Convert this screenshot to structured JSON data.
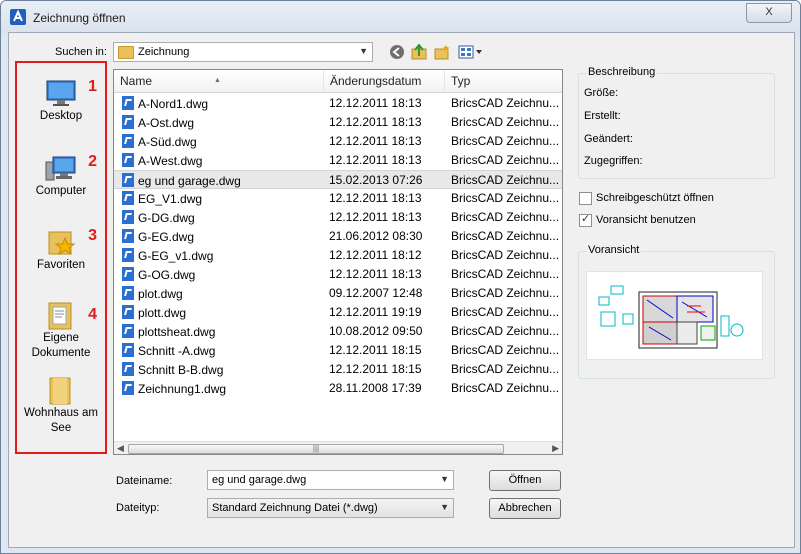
{
  "window": {
    "title": "Zeichnung öffnen",
    "close_glyph": "X"
  },
  "toolbar": {
    "look_in_label": "Suchen in:",
    "look_in_value": "Zeichnung",
    "icons": [
      "back-icon",
      "up-folder-icon",
      "new-folder-icon",
      "view-menu-icon"
    ]
  },
  "places": [
    {
      "label": "Desktop",
      "num": "1",
      "icon": "desktop-icon"
    },
    {
      "label": "Computer",
      "num": "2",
      "icon": "computer-icon"
    },
    {
      "label": "Favoriten",
      "num": "3",
      "icon": "favorites-icon"
    },
    {
      "label": "Eigene Dokumente",
      "num": "4",
      "icon": "documents-icon"
    },
    {
      "label": "Wohnhaus am See",
      "num": "",
      "icon": "folder-icon"
    }
  ],
  "columns": {
    "name": "Name",
    "date": "Änderungsdatum",
    "type": "Typ"
  },
  "files": [
    {
      "name": "A-Nord1.dwg",
      "date": "12.12.2011 18:13",
      "type": "BricsCAD Zeichnu..."
    },
    {
      "name": "A-Ost.dwg",
      "date": "12.12.2011 18:13",
      "type": "BricsCAD Zeichnu..."
    },
    {
      "name": "A-Süd.dwg",
      "date": "12.12.2011 18:13",
      "type": "BricsCAD Zeichnu..."
    },
    {
      "name": "A-West.dwg",
      "date": "12.12.2011 18:13",
      "type": "BricsCAD Zeichnu..."
    },
    {
      "name": "eg und garage.dwg",
      "date": "15.02.2013 07:26",
      "type": "BricsCAD Zeichnu...",
      "selected": true
    },
    {
      "name": "EG_V1.dwg",
      "date": "12.12.2011 18:13",
      "type": "BricsCAD Zeichnu..."
    },
    {
      "name": "G-DG.dwg",
      "date": "12.12.2011 18:13",
      "type": "BricsCAD Zeichnu..."
    },
    {
      "name": "G-EG.dwg",
      "date": "21.06.2012 08:30",
      "type": "BricsCAD Zeichnu..."
    },
    {
      "name": "G-EG_v1.dwg",
      "date": "12.12.2011 18:12",
      "type": "BricsCAD Zeichnu..."
    },
    {
      "name": "G-OG.dwg",
      "date": "12.12.2011 18:13",
      "type": "BricsCAD Zeichnu..."
    },
    {
      "name": "plot.dwg",
      "date": "09.12.2007 12:48",
      "type": "BricsCAD Zeichnu..."
    },
    {
      "name": "plott.dwg",
      "date": "12.12.2011 19:19",
      "type": "BricsCAD Zeichnu..."
    },
    {
      "name": "plottsheat.dwg",
      "date": "10.08.2012 09:50",
      "type": "BricsCAD Zeichnu..."
    },
    {
      "name": "Schnitt -A.dwg",
      "date": "12.12.2011 18:15",
      "type": "BricsCAD Zeichnu..."
    },
    {
      "name": "Schnitt B-B.dwg",
      "date": "12.12.2011 18:15",
      "type": "BricsCAD Zeichnu..."
    },
    {
      "name": "Zeichnung1.dwg",
      "date": "28.11.2008 17:39",
      "type": "BricsCAD Zeichnu..."
    }
  ],
  "filename": {
    "label": "Dateiname:",
    "value": "eg und garage.dwg"
  },
  "filetype": {
    "label": "Dateityp:",
    "value": "Standard Zeichnung Datei (*.dwg)"
  },
  "buttons": {
    "open": "Öffnen",
    "cancel": "Abbrechen"
  },
  "description": {
    "title": "Beschreibung",
    "size": "Größe:",
    "created": "Erstellt:",
    "modified": "Geändert:",
    "accessed": "Zugegriffen:"
  },
  "options": {
    "readonly": {
      "label": "Schreibgeschützt öffnen",
      "checked": false
    },
    "preview": {
      "label": "Voransicht benutzen",
      "checked": true
    }
  },
  "preview_title": "Voransicht",
  "scroll_grip": "|||",
  "colors": {
    "highlight": "#e21b1b",
    "file_icon": "#2b6fd1"
  }
}
